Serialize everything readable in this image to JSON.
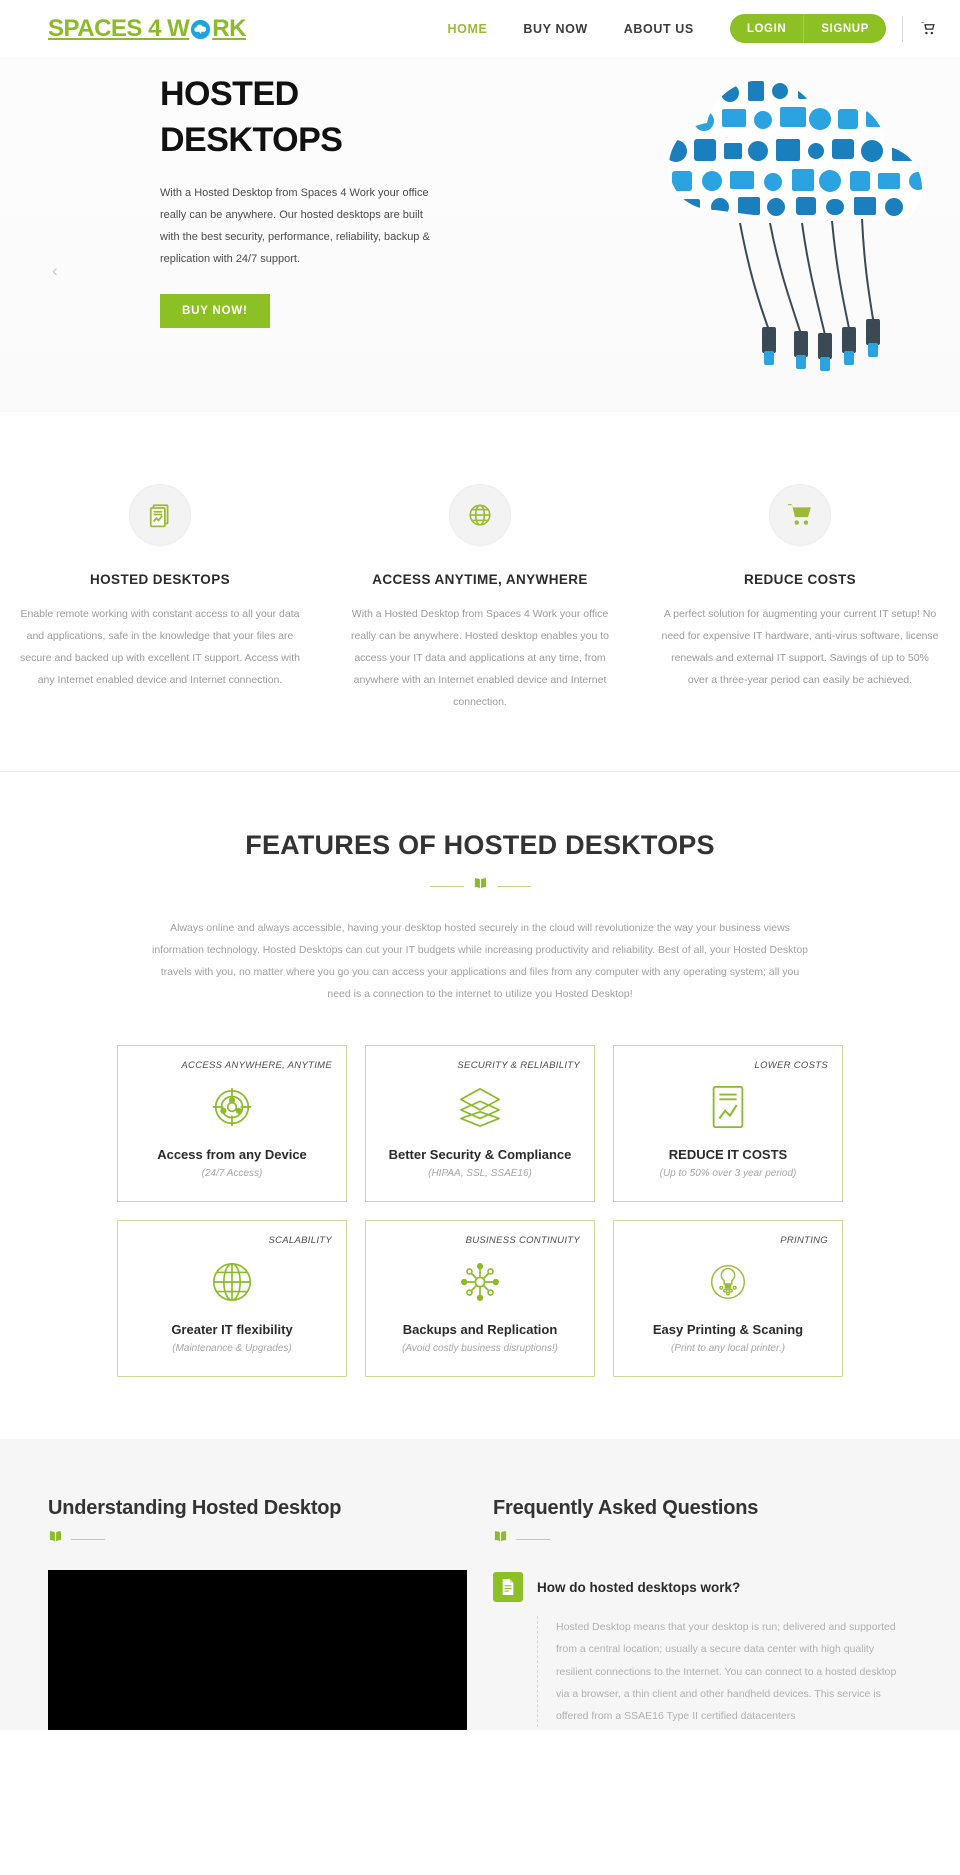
{
  "header": {
    "logo_text_before": "SPACES 4 W",
    "logo_icon": "cloud-upload-icon",
    "logo_text_after": "RK",
    "nav": [
      {
        "label": "HOME",
        "active": true
      },
      {
        "label": "BUY NOW",
        "active": false
      },
      {
        "label": "ABOUT US",
        "active": false
      }
    ],
    "login_label": "LOGIN",
    "signup_label": "SIGNUP",
    "cart_icon": "shopping-cart-icon"
  },
  "hero": {
    "title_line1": "HOSTED",
    "title_line2": "DESKTOPS",
    "paragraph": "With a Hosted Desktop from Spaces 4 Work your office really can be anywhere. Our hosted desktops are built with the best security, performance, reliability, backup & replication with 24/7 support.",
    "cta_label": "BUY NOW!",
    "prev_arrow": "‹",
    "art_alt": "cloud-of-technology-icons-illustration",
    "dots": 1,
    "active_dot": 0,
    "accent_color": "#8cc024"
  },
  "trio": [
    {
      "icon": "report-document-icon",
      "title": "HOSTED DESKTOPS",
      "body": "Enable remote working with constant access to all your data and applications, safe in the knowledge that your files are secure and backed up with excellent IT support. Access with any Internet enabled device and Internet connection."
    },
    {
      "icon": "globe-network-icon",
      "title": "ACCESS ANYTIME, ANYWHERE",
      "body": "With a Hosted Desktop from Spaces 4 Work your office really can be anywhere. Hosted desktop enables you to access your IT data and applications at any time, from anywhere with an Internet enabled device and Internet connection."
    },
    {
      "icon": "shopping-cart-icon",
      "title": "REDUCE COSTS",
      "body": "A perfect solution for augmenting your current IT setup! No need for expensive IT hardware, anti-virus software, license renewals and external IT support. Savings of up to 50% over a three-year period can easily be achieved."
    }
  ],
  "features": {
    "title": "FEATURES OF HOSTED DESKTOPS",
    "divider_icon": "open-book-icon",
    "body": "Always online and always accessible, having your desktop hosted securely in the cloud will revolutionize the way your business views information technology. Hosted Desktops can cut your IT budgets while increasing productivity and reliability. Best of all, your Hosted Desktop travels with you, no matter where you go you can access your applications and files from any computer with any operating system; all you need is a connection to the internet to utilize you Hosted Desktop!",
    "cards": [
      {
        "tag": "ACCESS ANYWHERE, ANYTIME",
        "icon": "target-network-icon",
        "title": "Access from any Device",
        "note": "(24/7 Access)"
      },
      {
        "tag": "SECURITY & RELIABILITY",
        "icon": "layers-stack-icon",
        "title": "Better Security & Compliance",
        "note": "(HIPAA, SSL, SSAE16)"
      },
      {
        "tag": "LOWER COSTS",
        "icon": "chart-report-icon",
        "title": "REDUCE IT COSTS",
        "note": "(Up to 50% over 3 year period)"
      },
      {
        "tag": "SCALABILITY",
        "icon": "globe-icon",
        "title": "Greater IT flexibility",
        "note": "(Maintenance & Upgrades)"
      },
      {
        "tag": "BUSINESS CONTINUITY",
        "icon": "network-nodes-icon",
        "title": "Backups and Replication",
        "note": "(Avoid costly business disruptions!)"
      },
      {
        "tag": "PRINTING",
        "icon": "lightbulb-idea-icon",
        "title": "Easy Printing & Scaning",
        "note": "(Print to any local printer.)"
      }
    ]
  },
  "bottom": {
    "left_title": "Understanding Hosted Desktop",
    "right_title": "Frequently Asked Questions",
    "divider_icon": "open-book-icon",
    "video_placeholder": "video-player",
    "faq": [
      {
        "icon": "doc-file-icon",
        "question": "How do hosted desktops work?",
        "answer": "Hosted Desktop means that your desktop is run; delivered and supported from a central location; usually a secure data center with high quality resilient connections to the Internet. You can connect to a hosted desktop via a browser, a thin client and other handheld devices. This service is offered from a SSAE16 Type II certified datacenters"
      }
    ]
  }
}
